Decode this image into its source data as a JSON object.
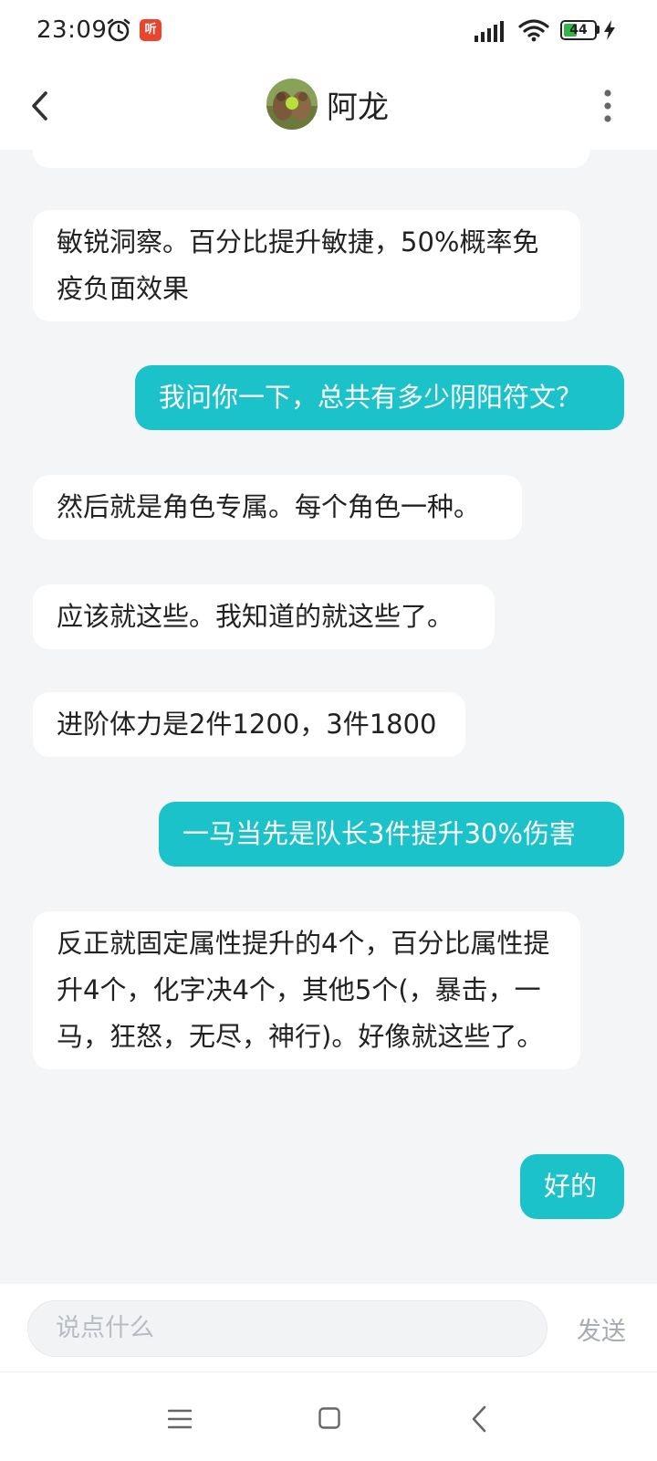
{
  "status_bar": {
    "time": "23:09",
    "app_badge": "听",
    "battery_level": "44",
    "icons": [
      "alarm-icon",
      "app-notification-icon",
      "signal-icon",
      "wifi-icon",
      "battery-icon",
      "charging-icon"
    ]
  },
  "header": {
    "title": "阿龙",
    "icons": [
      "back-icon",
      "avatar",
      "more-icon"
    ]
  },
  "messages": [
    {
      "side": "left",
      "text": "敏锐洞察。百分比提升敏捷，50%概率免疫负面效果"
    },
    {
      "side": "right",
      "text": "我问你一下，总共有多少阴阳符文？"
    },
    {
      "side": "left",
      "text": "然后就是角色专属。每个角色一种。"
    },
    {
      "side": "left",
      "text": "应该就这些。我知道的就这些了。"
    },
    {
      "side": "left",
      "text": "进阶体力是2件1200，3件1800"
    },
    {
      "side": "right",
      "text": "一马当先是队长3件提升30%伤害"
    },
    {
      "side": "left",
      "text": "反正就固定属性提升的4个，百分比属性提升4个，化字决4个，其他5个(，暴击，一马，狂怒，无尽，神行)。好像就这些了。"
    },
    {
      "side": "right",
      "text": "好的"
    }
  ],
  "composer": {
    "placeholder": "说点什么",
    "send_label": "发送"
  },
  "nav_bar": {
    "icons": [
      "menu-icon",
      "home-icon",
      "back-nav-icon"
    ]
  },
  "colors": {
    "accent": "#1cc2c9",
    "chat_background": "#f3f5f7",
    "bubble_left": "#ffffff"
  }
}
